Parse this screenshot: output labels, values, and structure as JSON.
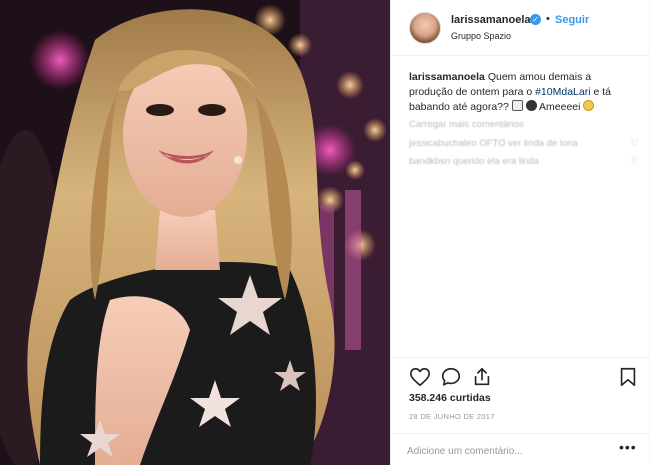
{
  "post": {
    "username": "larissamanoela",
    "follow_label": "Seguir",
    "separator": "•",
    "location": "Gruppo Spazio",
    "caption": {
      "username": "larissamanoela",
      "text_1": "Quem amou demais a produção de ontem para o",
      "hashtag": "#10MdaLari",
      "text_2": "e tá babando até agora??",
      "text_3": "Ameeeei"
    },
    "load_more_comments": "Carregar mais comentários",
    "comments": [
      {
        "user": "jessicabuchaleo",
        "text": "OFTO ver linda de lona"
      },
      {
        "user": "bandkbsn",
        "text": "querido ela era linda"
      }
    ],
    "likes": "358.246 curtidas",
    "date": "28 DE JUNHO DE 2017",
    "comment_placeholder": "Adicione um comentário...",
    "more_options": "•••"
  },
  "icons": {
    "like": "heart-icon",
    "comment": "comment-bubble-icon",
    "share": "share-icon",
    "save": "bookmark-icon",
    "verified": "verified-badge-icon"
  },
  "colors": {
    "link_blue": "#3897f0",
    "hashtag": "#003569",
    "verified": "#3897f0"
  }
}
